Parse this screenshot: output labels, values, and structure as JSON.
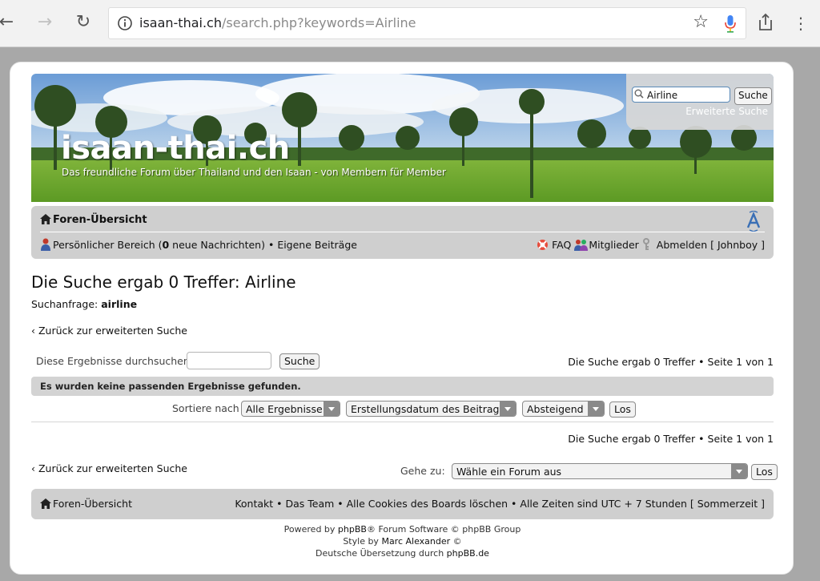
{
  "browser": {
    "url_domain": "isaan-thai.ch",
    "url_path": "/search.php?keywords=Airline"
  },
  "header": {
    "site_name": "isaan-thai.ch",
    "tagline": "Das freundliche Forum über Thailand und den Isaan - von Membern für Member",
    "search_value": "Airline",
    "search_button": "Suche",
    "advanced_search": "Erweiterte Suche"
  },
  "navbar": {
    "home": "Foren-Übersicht",
    "personal_pre": "Persönlicher Bereich (",
    "personal_count": "0",
    "personal_post": " neue Nachrichten)",
    "separator": " • ",
    "own_posts": "Eigene Beiträge",
    "faq": "FAQ",
    "members": "Mitglieder",
    "logout": "Abmelden [ Johnboy ]"
  },
  "main": {
    "title_prefix": "Die Suche ergab 0 Treffer: ",
    "title_keyword": "Airline",
    "query_label": "Suchanfrage: ",
    "query_value": "airline",
    "back_link": "Zurück zur erweiterten Suche",
    "filter_label": "Diese Ergebnisse durchsuchen:",
    "filter_button": "Suche",
    "page_info": "Die Suche ergab 0 Treffer • Seite 1 von 1",
    "no_results": "Es wurden keine passenden Ergebnisse gefunden.",
    "sort_label": "Sortiere nach",
    "sort_scope": "Alle Ergebnisse",
    "sort_key": "Erstellungsdatum des Beitrags",
    "sort_dir": "Absteigend",
    "go_button": "Los",
    "jump_label": "Gehe zu:",
    "jump_select": "Wähle ein Forum aus",
    "jump_button": "Los"
  },
  "footer": {
    "home": "Foren-Übersicht",
    "links": "Kontakt • Das Team • Alle Cookies des Boards löschen • Alle Zeiten sind UTC + 7 Stunden [ Sommerzeit ]",
    "powered_pre": "Powered by ",
    "powered_link": "phpBB",
    "powered_post": "® Forum Software © phpBB Group",
    "style_pre": "Style by ",
    "style_link": "Marc Alexander",
    "style_post": " ©",
    "translation_pre": "Deutsche Übersetzung durch ",
    "translation_link": "phpBB.de"
  },
  "colors": {
    "page_bg": "#a8a8a8",
    "bar_gray": "#cfcfcf",
    "mic_blue": "#4285f4"
  }
}
